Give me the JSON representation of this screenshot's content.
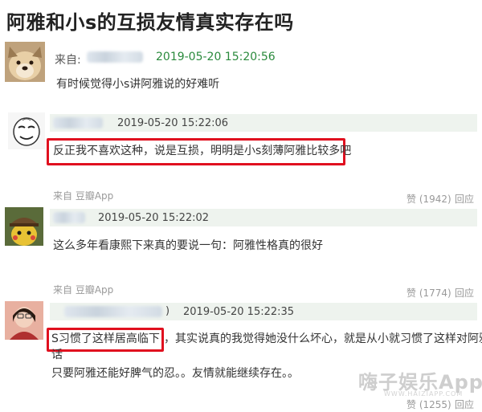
{
  "header": {
    "title": "阿雅和小s的互损友情真实存在吗"
  },
  "post": {
    "from_label": "来自:",
    "timestamp": "2019-05-20 15:20:56",
    "text": "有时候觉得小s讲阿雅说的好难听"
  },
  "comments": [
    {
      "timestamp": "2019-05-20 15:22:06",
      "text": "反正我不喜欢这种，说是互损，明明是小s刻薄阿雅比较多吧",
      "source": "来自 豆瓣App",
      "likes": "赞 (1942)",
      "reply": "回应"
    },
    {
      "timestamp": "2019-05-20 15:22:02",
      "text": "这么多年看康熙下来真的要说一句：阿雅性格真的很好",
      "source": "来自 豆瓣App",
      "likes": "赞 (1774)",
      "reply": "回应"
    },
    {
      "paren": ")",
      "timestamp": "2019-05-20 15:22:35",
      "text_highlight": "S习惯了这样居高临下",
      "text_rest": "，其实说真的我觉得她没什么坏心，就是从小就习惯了这样对阿雅说",
      "text_line2": "话",
      "text_line3": "只要阿雅还能好脾气的忍。。友情就能继续存在。。",
      "likes": "赞 (1255)",
      "reply": "回应"
    }
  ],
  "watermark": {
    "text": "嗨子娱乐App",
    "sub": "WWW.HAIZIAPP.COM"
  }
}
